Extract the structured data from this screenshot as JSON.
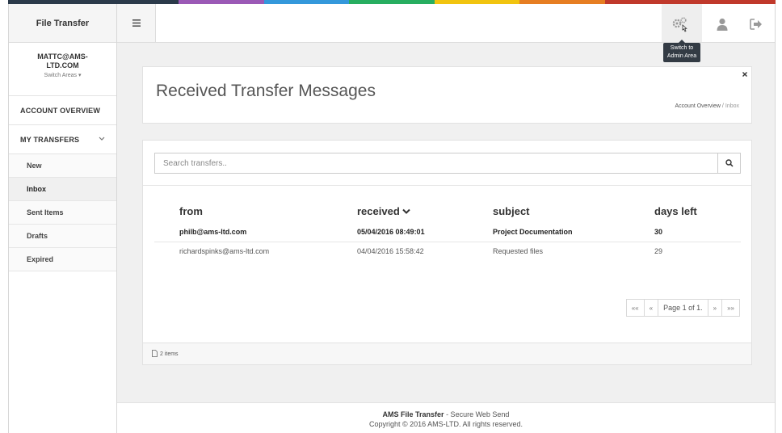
{
  "strip_colors": [
    "#2b3a4a",
    "#2b3a4a",
    "#9b59b6",
    "#3498db",
    "#27ae60",
    "#f1c40f",
    "#e67e22",
    "#c0392b",
    "#c0392b"
  ],
  "sidebar": {
    "brand": "File Transfer",
    "user": "MATTC@AMS-LTD.COM",
    "switch_areas": "Switch Areas ▾",
    "account_overview": "ACCOUNT OVERVIEW",
    "my_transfers": "MY TRANSFERS",
    "items": [
      {
        "label": "New"
      },
      {
        "label": "Inbox"
      },
      {
        "label": "Sent Items"
      },
      {
        "label": "Drafts"
      },
      {
        "label": "Expired"
      }
    ]
  },
  "topbar": {
    "tooltip": "Switch to Admin Area",
    "icons": [
      "hamburger-icon",
      "gear-icon",
      "user-icon",
      "logout-icon"
    ]
  },
  "page": {
    "title": "Received Transfer Messages",
    "breadcrumb_home": "Account Overview",
    "breadcrumb_sep": "/",
    "breadcrumb_current": "Inbox"
  },
  "search": {
    "placeholder": "Search transfers.."
  },
  "table": {
    "headers": [
      "from",
      "received",
      "subject",
      "days left"
    ],
    "rows": [
      {
        "from": "philb@ams-ltd.com",
        "received": "05/04/2016 08:49:01",
        "subject": "Project Documentation",
        "days_left": "30"
      },
      {
        "from": "richardspinks@ams-ltd.com",
        "received": "04/04/2016 15:58:42",
        "subject": "Requested files",
        "days_left": "29"
      }
    ]
  },
  "pager": {
    "first": "««",
    "prev": "«",
    "info": "Page 1 of 1.",
    "next": "»",
    "last": "»»"
  },
  "items_count": "2 items",
  "footer": {
    "brand": "AMS File Transfer",
    "tagline": " - Secure Web Send",
    "copyright": "Copyright © 2016 AMS-LTD. All rights reserved."
  }
}
